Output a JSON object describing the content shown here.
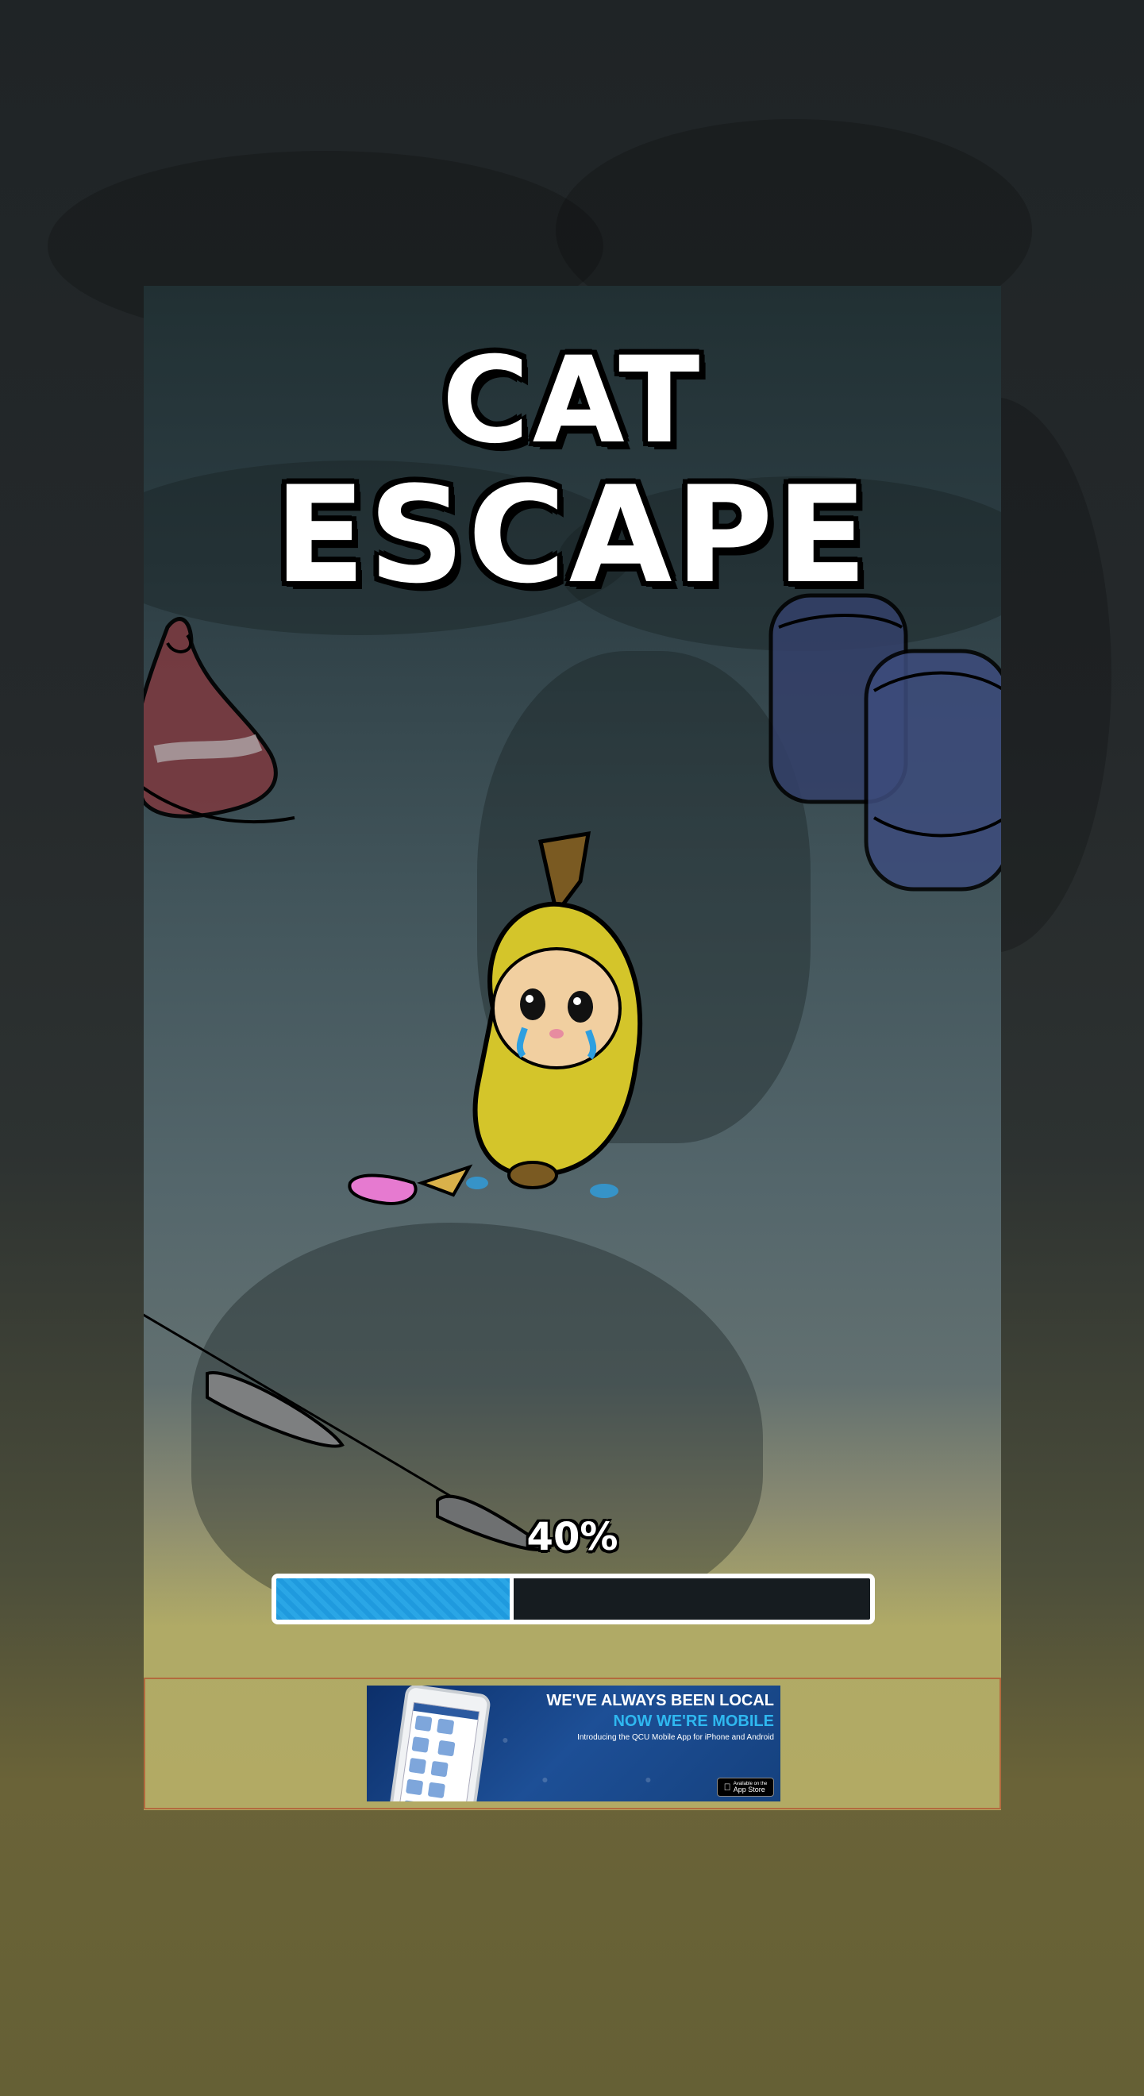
{
  "game": {
    "title_line1": "CAT",
    "title_line2": "ESCAPE",
    "loading_progress_text": "40%",
    "loading_progress_fraction": 0.4
  },
  "ad": {
    "headline": "WE'VE ALWAYS BEEN LOCAL",
    "subheadline": "NOW WE'RE MOBILE",
    "tagline": "Introducing the QCU Mobile App for iPhone and Android",
    "store_badge": "App Store",
    "store_badge_small": "Available on the"
  },
  "colors": {
    "progress_fill": "#1f9ade",
    "progress_track": "#161c20",
    "ad_border": "#b36a3e",
    "banana": "#d4c52a",
    "witch_hat": "#7a3a40",
    "barrel": "#34406a"
  },
  "icons": {
    "mascot": "banana-cat-icon",
    "hat": "witch-hat-icon",
    "barrels": "barrels-icon",
    "ice_cream": "dropped-ice-cream-icon",
    "knife": "knife-icon",
    "app_store": "apple-icon"
  }
}
